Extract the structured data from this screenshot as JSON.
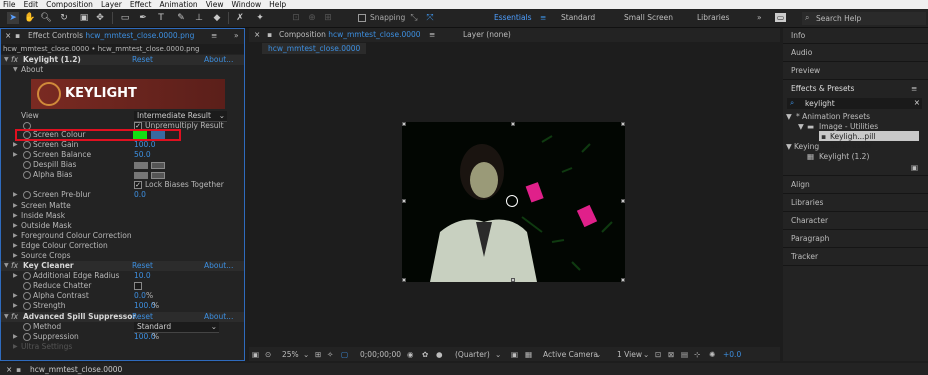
{
  "menu": [
    "File",
    "Edit",
    "Composition",
    "Layer",
    "Effect",
    "Animation",
    "View",
    "Window",
    "Help"
  ],
  "toolbar": {
    "snapping": "Snapping",
    "workspaces": [
      "Essentials",
      "Standard",
      "Small Screen",
      "Libraries"
    ],
    "search_placeholder": "Search Help",
    "more": "»"
  },
  "effect_controls": {
    "tab_prefix": "Effect Controls",
    "tab_file": "hcw_mmtest_close.0000.png",
    "breadcrumb": "hcw_mmtest_close.0000 • hcw_mmtest_close.0000.png",
    "keylight": {
      "title": "Keylight (1.2)",
      "reset": "Reset",
      "about": "About...",
      "about_section": "About",
      "logo_text": "KEYLIGHT",
      "view_label": "View",
      "view_value": "Intermediate Result",
      "unpremultiply": "Unpremultiply Result",
      "screen_colour": "Screen Colour",
      "screen_gain": "Screen Gain",
      "screen_gain_value": "100.0",
      "screen_balance": "Screen Balance",
      "screen_balance_value": "50.0",
      "despill_bias": "Despill Bias",
      "alpha_bias": "Alpha Bias",
      "lock_biases": "Lock Biases Together",
      "screen_preblur": "Screen Pre-blur",
      "screen_preblur_value": "0.0",
      "groups": [
        "Screen Matte",
        "Inside Mask",
        "Outside Mask",
        "Foreground Colour Correction",
        "Edge Colour Correction",
        "Source Crops"
      ]
    },
    "key_cleaner": {
      "title": "Key Cleaner",
      "reset": "Reset",
      "about": "About...",
      "additional_edge_radius": "Additional Edge Radius",
      "additional_edge_radius_value": "10.0",
      "reduce_chatter": "Reduce Chatter",
      "alpha_contrast": "Alpha Contrast",
      "alpha_contrast_value": "0.0",
      "alpha_contrast_unit": "%",
      "strength": "Strength",
      "strength_value": "100.0",
      "strength_unit": "%"
    },
    "spill_suppressor": {
      "title": "Advanced Spill Suppressor",
      "reset": "Reset",
      "about": "About...",
      "method": "Method",
      "method_value": "Standard",
      "suppression": "Suppression",
      "suppression_value": "100.0",
      "suppression_unit": "%",
      "ultra_settings": "Ultra Settings"
    }
  },
  "composition": {
    "tab_prefix": "Composition",
    "tab_name": "hcw_mmtest_close.0000",
    "layer_label": "Layer (none)",
    "subtab": "hcw_mmtest_close.0000",
    "zoom": "25%",
    "timecode": "0;00;00;00",
    "resolution": "(Quarter)",
    "camera": "Active Camera",
    "views": "1 View",
    "exposure": "+0.0"
  },
  "right_panel": {
    "info": "Info",
    "audio": "Audio",
    "preview": "Preview",
    "effects_presets": "Effects & Presets",
    "search_value": "keylight",
    "animation_presets": "* Animation Presets",
    "image_utilities": "Image - Utilities",
    "preset_item": "Keyligh...pill Suppressor",
    "keying": "Keying",
    "keylight_item": "Keylight (1.2)",
    "panels": [
      "Align",
      "Libraries",
      "Character",
      "Paragraph",
      "Tracker"
    ]
  },
  "timeline": {
    "tab_name": "hcw_mmtest_close.0000"
  },
  "colors": {
    "accent_blue": "#3d8fe0",
    "screen_colour": "#12e012",
    "highlight_red": "#e01020"
  }
}
